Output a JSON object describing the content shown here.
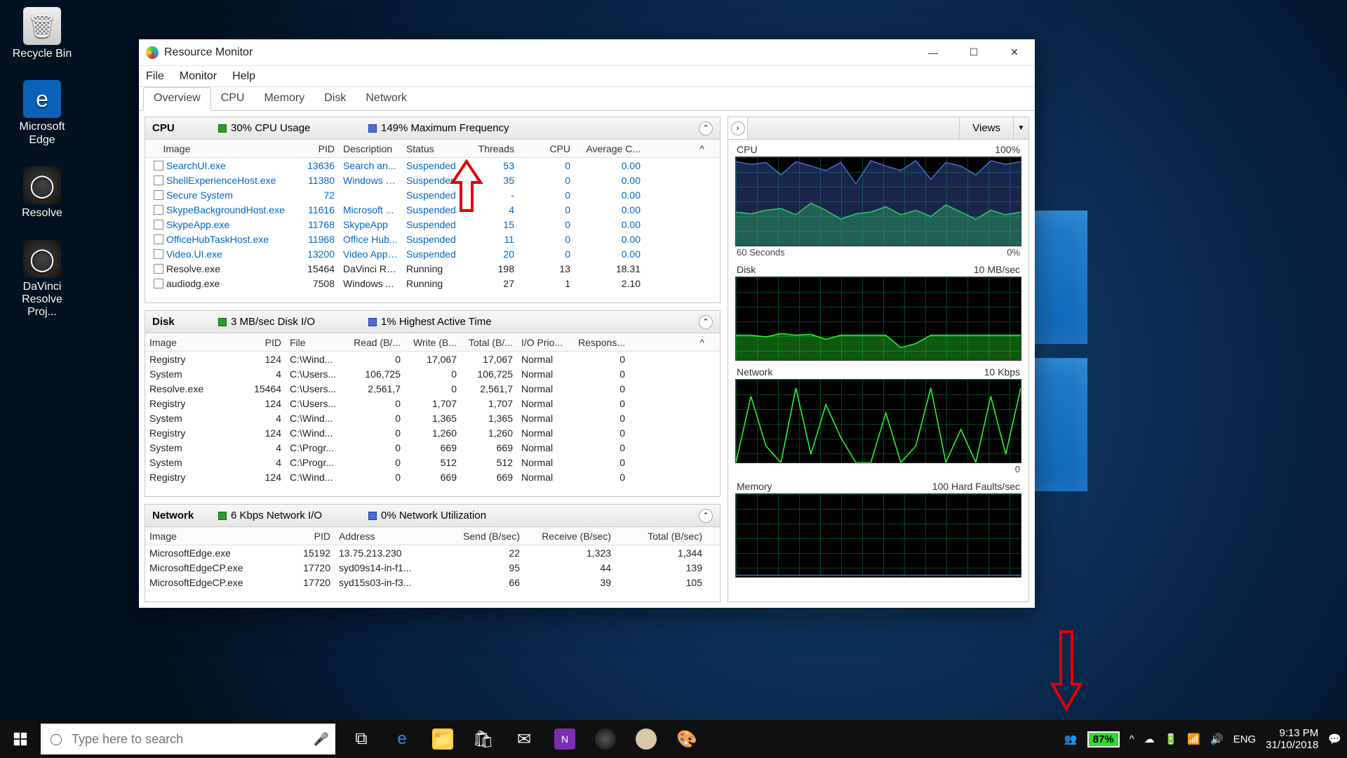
{
  "desktop": {
    "icons": [
      {
        "label": "Recycle Bin",
        "style": "ic-bin",
        "glyph": "🗑"
      },
      {
        "label": "Microsoft Edge",
        "style": "ic-edge",
        "glyph": "e"
      },
      {
        "label": "Resolve",
        "style": "ic-dark",
        "glyph": "◯"
      },
      {
        "label": "DaVinci Resolve Proj...",
        "style": "ic-dark",
        "glyph": "◯"
      }
    ]
  },
  "window": {
    "title": "Resource Monitor",
    "menu": [
      "File",
      "Monitor",
      "Help"
    ],
    "tabs": [
      "Overview",
      "CPU",
      "Memory",
      "Disk",
      "Network"
    ],
    "active_tab": "Overview"
  },
  "cpu_panel": {
    "title": "CPU",
    "meter1": "30% CPU Usage",
    "meter2": "149% Maximum Frequency",
    "columns": [
      "Image",
      "PID",
      "Description",
      "Status",
      "Threads",
      "CPU",
      "Average C..."
    ],
    "rows": [
      {
        "link": true,
        "image": "SearchUI.exe",
        "pid": "13636",
        "desc": "Search an...",
        "status": "Suspended",
        "threads": "53",
        "cpu": "0",
        "avg": "0.00"
      },
      {
        "link": true,
        "image": "ShellExperienceHost.exe",
        "pid": "11380",
        "desc": "Windows S...",
        "status": "Suspended",
        "threads": "35",
        "cpu": "0",
        "avg": "0.00"
      },
      {
        "link": true,
        "image": "Secure System",
        "pid": "72",
        "desc": "",
        "status": "Suspended",
        "threads": "-",
        "cpu": "0",
        "avg": "0.00"
      },
      {
        "link": true,
        "image": "SkypeBackgroundHost.exe",
        "pid": "11616",
        "desc": "Microsoft ...",
        "status": "Suspended",
        "threads": "4",
        "cpu": "0",
        "avg": "0.00"
      },
      {
        "link": true,
        "image": "SkypeApp.exe",
        "pid": "11768",
        "desc": "SkypeApp",
        "status": "Suspended",
        "threads": "15",
        "cpu": "0",
        "avg": "0.00"
      },
      {
        "link": true,
        "image": "OfficeHubTaskHost.exe",
        "pid": "11968",
        "desc": "Office Hub...",
        "status": "Suspended",
        "threads": "11",
        "cpu": "0",
        "avg": "0.00"
      },
      {
        "link": true,
        "image": "Video.UI.exe",
        "pid": "13200",
        "desc": "Video Appl...",
        "status": "Suspended",
        "threads": "20",
        "cpu": "0",
        "avg": "0.00"
      },
      {
        "link": false,
        "image": "Resolve.exe",
        "pid": "15464",
        "desc": "DaVinci Re...",
        "status": "Running",
        "threads": "198",
        "cpu": "13",
        "avg": "18.31"
      },
      {
        "link": false,
        "image": "audiodg.exe",
        "pid": "7508",
        "desc": "Windows ...",
        "status": "Running",
        "threads": "27",
        "cpu": "1",
        "avg": "2.10"
      }
    ]
  },
  "disk_panel": {
    "title": "Disk",
    "meter1": "3 MB/sec Disk I/O",
    "meter2": "1% Highest Active Time",
    "columns": [
      "Image",
      "PID",
      "File",
      "Read (B/...",
      "Write (B...",
      "Total (B/...",
      "I/O Prio...",
      "Respons..."
    ],
    "rows": [
      {
        "image": "Registry",
        "pid": "124",
        "file": "C:\\Wind...",
        "r": "0",
        "w": "17,067",
        "t": "17,067",
        "io": "Normal",
        "rsp": "0"
      },
      {
        "image": "System",
        "pid": "4",
        "file": "C:\\Users...",
        "r": "106,725",
        "w": "0",
        "t": "106,725",
        "io": "Normal",
        "rsp": "0"
      },
      {
        "image": "Resolve.exe",
        "pid": "15464",
        "file": "C:\\Users...",
        "r": "2,561,7",
        "w": "0",
        "t": "2,561,7",
        "io": "Normal",
        "rsp": "0"
      },
      {
        "image": "Registry",
        "pid": "124",
        "file": "C:\\Users...",
        "r": "0",
        "w": "1,707",
        "t": "1,707",
        "io": "Normal",
        "rsp": "0"
      },
      {
        "image": "System",
        "pid": "4",
        "file": "C:\\Wind...",
        "r": "0",
        "w": "1,365",
        "t": "1,365",
        "io": "Normal",
        "rsp": "0"
      },
      {
        "image": "Registry",
        "pid": "124",
        "file": "C:\\Wind...",
        "r": "0",
        "w": "1,260",
        "t": "1,260",
        "io": "Normal",
        "rsp": "0"
      },
      {
        "image": "System",
        "pid": "4",
        "file": "C:\\Progr...",
        "r": "0",
        "w": "669",
        "t": "669",
        "io": "Normal",
        "rsp": "0"
      },
      {
        "image": "System",
        "pid": "4",
        "file": "C:\\Progr...",
        "r": "0",
        "w": "512",
        "t": "512",
        "io": "Normal",
        "rsp": "0"
      },
      {
        "image": "Registry",
        "pid": "124",
        "file": "C:\\Wind...",
        "r": "0",
        "w": "669",
        "t": "669",
        "io": "Normal",
        "rsp": "0"
      }
    ]
  },
  "net_panel": {
    "title": "Network",
    "meter1": "6 Kbps Network I/O",
    "meter2": "0% Network Utilization",
    "columns": [
      "Image",
      "PID",
      "Address",
      "Send (B/sec)",
      "Receive (B/sec)",
      "Total (B/sec)"
    ],
    "rows": [
      {
        "image": "MicrosoftEdge.exe",
        "pid": "15192",
        "addr": "13.75.213.230",
        "s": "22",
        "r": "1,323",
        "t": "1,344"
      },
      {
        "image": "MicrosoftEdgeCP.exe",
        "pid": "17720",
        "addr": "syd09s14-in-f1...",
        "s": "95",
        "r": "44",
        "t": "139"
      },
      {
        "image": "MicrosoftEdgeCP.exe",
        "pid": "17720",
        "addr": "syd15s03-in-f3...",
        "s": "66",
        "r": "39",
        "t": "105"
      }
    ]
  },
  "charts": {
    "views_label": "Views",
    "blocks": [
      {
        "title": "CPU",
        "right": "100%",
        "foot_l": "60 Seconds",
        "foot_r": "0%"
      },
      {
        "title": "Disk",
        "right": "10 MB/sec",
        "foot_l": "",
        "foot_r": ""
      },
      {
        "title": "Network",
        "right": "10 Kbps",
        "foot_l": "",
        "foot_r": "0"
      },
      {
        "title": "Memory",
        "right": "100 Hard Faults/sec",
        "foot_l": "",
        "foot_r": ""
      }
    ]
  },
  "chart_data": [
    {
      "type": "area",
      "title": "CPU",
      "ylim": [
        0,
        100
      ],
      "xlabel": "60 Seconds",
      "ylabel": "%",
      "series": [
        {
          "name": "CPU Usage",
          "color": "#2bff2b",
          "values": [
            38,
            36,
            40,
            42,
            35,
            48,
            40,
            30,
            36,
            38,
            44,
            35,
            40,
            33,
            46,
            38,
            30,
            40,
            35,
            38
          ]
        },
        {
          "name": "Max Frequency",
          "color": "#4a6bd8",
          "values": [
            95,
            92,
            94,
            80,
            95,
            90,
            85,
            94,
            70,
            96,
            90,
            85,
            96,
            75,
            94,
            90,
            80,
            96,
            92,
            95
          ]
        }
      ]
    },
    {
      "type": "area",
      "title": "Disk",
      "ylim": [
        0,
        10
      ],
      "ylabel": "MB/sec",
      "series": [
        {
          "name": "Disk I/O",
          "color": "#2bff2b",
          "values": [
            3,
            3,
            2.8,
            3.2,
            3,
            3.1,
            2.5,
            3,
            3,
            3,
            3,
            1.5,
            2,
            3,
            3,
            3,
            3,
            3,
            3,
            3
          ]
        }
      ]
    },
    {
      "type": "line",
      "title": "Network",
      "ylim": [
        0,
        10
      ],
      "ylabel": "Kbps",
      "series": [
        {
          "name": "Network I/O",
          "color": "#2bff2b",
          "values": [
            0,
            8,
            2,
            0,
            9,
            1,
            7,
            3,
            0,
            0,
            6,
            0,
            2,
            9,
            0,
            4,
            0,
            8,
            1,
            9
          ]
        }
      ]
    },
    {
      "type": "line",
      "title": "Memory",
      "ylim": [
        0,
        100
      ],
      "ylabel": "Hard Faults/sec",
      "series": [
        {
          "name": "Hard Faults",
          "color": "#4a6bd8",
          "values": [
            2,
            2,
            2,
            2,
            2,
            2,
            2,
            2,
            2,
            2,
            2,
            2,
            2,
            2,
            2,
            2,
            2,
            2,
            2,
            2
          ]
        }
      ]
    }
  ],
  "taskbar": {
    "search_placeholder": "Type here to search",
    "battery": "87%",
    "lang": "ENG",
    "time": "9:13 PM",
    "date": "31/10/2018"
  }
}
